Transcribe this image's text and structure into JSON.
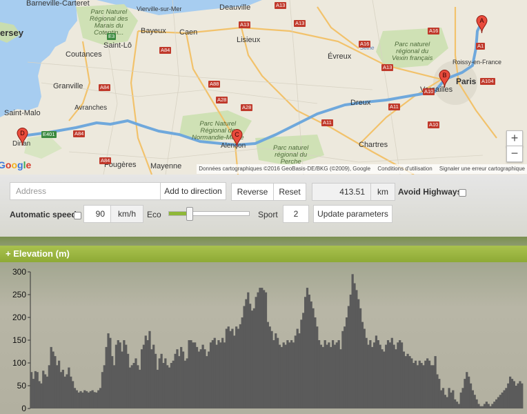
{
  "map": {
    "places": [
      {
        "id": "barneville",
        "text": "Barneville-Carteret"
      },
      {
        "id": "vierville",
        "text": "Vierville-sur-Mer"
      },
      {
        "id": "deauville",
        "text": "Deauville"
      },
      {
        "id": "jersey",
        "text": "ersey"
      },
      {
        "id": "bayeux",
        "text": "Bayeux"
      },
      {
        "id": "caen",
        "text": "Caen"
      },
      {
        "id": "lisieux",
        "text": "Lisieux"
      },
      {
        "id": "saintlo",
        "text": "Saint-Lô"
      },
      {
        "id": "coutances",
        "text": "Coutances"
      },
      {
        "id": "evreux",
        "text": "Évreux"
      },
      {
        "id": "granville",
        "text": "Granville"
      },
      {
        "id": "roissy",
        "text": "Roissy-en-France"
      },
      {
        "id": "paris",
        "text": "Paris"
      },
      {
        "id": "versailles",
        "text": "Versailles"
      },
      {
        "id": "dreux",
        "text": "Dreux"
      },
      {
        "id": "saintmalo",
        "text": "Saint-Malo"
      },
      {
        "id": "avranches",
        "text": "Avranches"
      },
      {
        "id": "dinan",
        "text": "Dinan"
      },
      {
        "id": "alencon",
        "text": "Alençon"
      },
      {
        "id": "chartres",
        "text": "Chartres"
      },
      {
        "id": "fougeres",
        "text": "Fougères"
      },
      {
        "id": "mayenne",
        "text": "Mayenne"
      },
      {
        "id": "seine",
        "text": "Seine"
      }
    ],
    "parks": [
      {
        "id": "cotentin",
        "lines": [
          "Parc Naturel",
          "Régional des",
          "Marais du",
          "Cotentin..."
        ]
      },
      {
        "id": "vexin",
        "lines": [
          "Parc naturel",
          "régional du",
          "Vexin français"
        ]
      },
      {
        "id": "normandie-maine",
        "lines": [
          "Parc Naturel",
          "Régional de",
          "Normandie-Maine"
        ]
      },
      {
        "id": "perche",
        "lines": [
          "Parc naturel",
          "régional du",
          "Perche"
        ]
      }
    ],
    "roads": [
      "A13",
      "A13",
      "A13",
      "A16",
      "A16",
      "A84",
      "A84",
      "A84",
      "A28",
      "A28",
      "A88",
      "A13",
      "A1",
      "A104",
      "A10",
      "A11",
      "A11",
      "A10",
      "A84",
      "E401",
      "E3"
    ],
    "markers": [
      "A",
      "B",
      "C",
      "D"
    ],
    "zoom_in": "+",
    "zoom_out": "−",
    "google_logo": "Google",
    "attribution": "Données cartographiques ©2016 GeoBasis-DE/BKG (©2009), Google",
    "terms": "Conditions d'utilisation",
    "report": "Signaler une erreur cartographique",
    "route_color": "#6fa8dc"
  },
  "controls": {
    "address_placeholder": "Address",
    "add_direction": "Add to direction",
    "reverse": "Reverse",
    "reset": "Reset",
    "distance": "413.51",
    "distance_unit": "km",
    "avoid_highways": "Avoid Highways",
    "automatic_speed": "Automatic speed",
    "speed": "90",
    "speed_unit": "km/h",
    "eco": "Eco",
    "sport": "Sport",
    "slider_value": 0.25,
    "sport_value": "2",
    "update": "Update parameters"
  },
  "elevation": {
    "header": "+ Elevation (m)",
    "chart_data": {
      "type": "bar",
      "ylabel": "",
      "ylim": [
        0,
        300
      ],
      "yticks": [
        0,
        50,
        100,
        150,
        200,
        250,
        300
      ],
      "values": [
        80,
        65,
        82,
        80,
        60,
        55,
        83,
        75,
        70,
        95,
        135,
        125,
        115,
        95,
        105,
        80,
        85,
        70,
        75,
        90,
        70,
        60,
        45,
        40,
        35,
        38,
        35,
        40,
        38,
        35,
        38,
        40,
        36,
        35,
        40,
        45,
        80,
        95,
        135,
        165,
        155,
        115,
        95,
        140,
        150,
        145,
        125,
        150,
        140,
        120,
        90,
        95,
        100,
        110,
        95,
        85,
        130,
        140,
        160,
        150,
        170,
        130,
        140,
        120,
        85,
        110,
        120,
        100,
        110,
        95,
        90,
        100,
        105,
        120,
        130,
        115,
        135,
        125,
        105,
        110,
        150,
        150,
        145,
        145,
        135,
        125,
        130,
        140,
        130,
        115,
        125,
        145,
        150,
        155,
        140,
        150,
        145,
        155,
        145,
        175,
        180,
        170,
        175,
        160,
        180,
        175,
        185,
        200,
        225,
        240,
        255,
        230,
        215,
        220,
        245,
        255,
        265,
        265,
        260,
        255,
        190,
        180,
        170,
        150,
        165,
        155,
        140,
        135,
        145,
        140,
        150,
        145,
        150,
        145,
        160,
        175,
        165,
        195,
        210,
        245,
        265,
        250,
        235,
        220,
        200,
        180,
        150,
        140,
        135,
        150,
        140,
        145,
        135,
        150,
        140,
        145,
        150,
        130,
        170,
        180,
        200,
        225,
        250,
        295,
        275,
        260,
        240,
        220,
        190,
        175,
        155,
        140,
        150,
        135,
        145,
        160,
        150,
        140,
        130,
        125,
        140,
        150,
        145,
        155,
        140,
        130,
        145,
        150,
        145,
        125,
        115,
        120,
        115,
        110,
        100,
        105,
        95,
        105,
        100,
        95,
        105,
        110,
        105,
        95,
        95,
        115,
        75,
        65,
        40,
        45,
        30,
        25,
        45,
        35,
        40,
        20,
        15,
        10,
        35,
        45,
        65,
        80,
        70,
        55,
        40,
        30,
        20,
        10,
        5,
        5,
        10,
        15,
        10,
        5,
        10,
        15,
        20,
        25,
        30,
        35,
        40,
        45,
        55,
        70,
        65,
        60,
        50,
        55,
        60,
        55
      ]
    }
  }
}
